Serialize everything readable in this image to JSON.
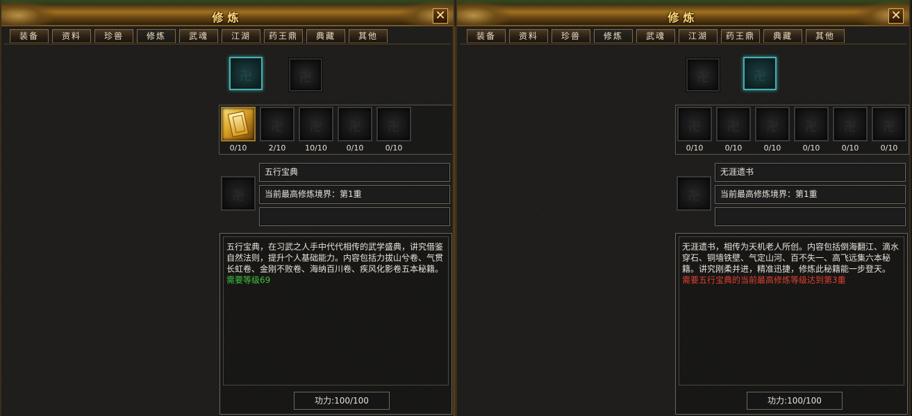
{
  "panels": [
    {
      "title": "修炼",
      "close_label": "✕",
      "tabs": [
        "装备",
        "资料",
        "珍兽",
        "修炼",
        "武魂",
        "江湖",
        "药王鼎",
        "典藏",
        "其他"
      ],
      "active_tab": 3,
      "skills": [
        {
          "progress": "0/10",
          "icon": "gold-book-icon"
        },
        {
          "progress": "2/10",
          "icon": "empty-slot"
        },
        {
          "progress": "10/10",
          "icon": "empty-slot"
        },
        {
          "progress": "0/10",
          "icon": "empty-slot"
        },
        {
          "progress": "0/10",
          "icon": "empty-slot"
        }
      ],
      "book_name": "五行宝典",
      "realm": "当前最高修炼境界：第1重",
      "extra": "",
      "description": "五行宝典，在习武之人手中代代相传的武学盛典，讲究借鉴自然法则，提升个人基础能力。内容包括力拔山兮卷、气贯长虹卷、金刚不败卷、海纳百川卷、疾风化影卷五本秘籍。",
      "requirement": "需要等级69",
      "requirement_color": "#3ec43e",
      "power": "功力:100/100"
    },
    {
      "title": "修炼",
      "close_label": "✕",
      "tabs": [
        "装备",
        "资料",
        "珍兽",
        "修炼",
        "武魂",
        "江湖",
        "药王鼎",
        "典藏",
        "其他"
      ],
      "active_tab": 3,
      "skills": [
        {
          "progress": "0/10",
          "icon": "empty-slot"
        },
        {
          "progress": "0/10",
          "icon": "empty-slot"
        },
        {
          "progress": "0/10",
          "icon": "empty-slot"
        },
        {
          "progress": "0/10",
          "icon": "empty-slot"
        },
        {
          "progress": "0/10",
          "icon": "empty-slot"
        },
        {
          "progress": "0/10",
          "icon": "empty-slot"
        }
      ],
      "book_name": "无涯遗书",
      "realm": "当前最高修炼境界：第1重",
      "extra": "",
      "description": "无涯遗书，相传为天机老人所创。内容包括倒海翻江、滴水穿石、铜墙铁壁、气定山河、百不失一、高飞远集六本秘籍。讲究刚柔并进，精准迅捷，修炼此秘籍能一步登天。",
      "requirement": "需要五行宝典的当前最高修炼等级达到第3重",
      "requirement_color": "#e04030",
      "power": "功力:100/100"
    }
  ]
}
